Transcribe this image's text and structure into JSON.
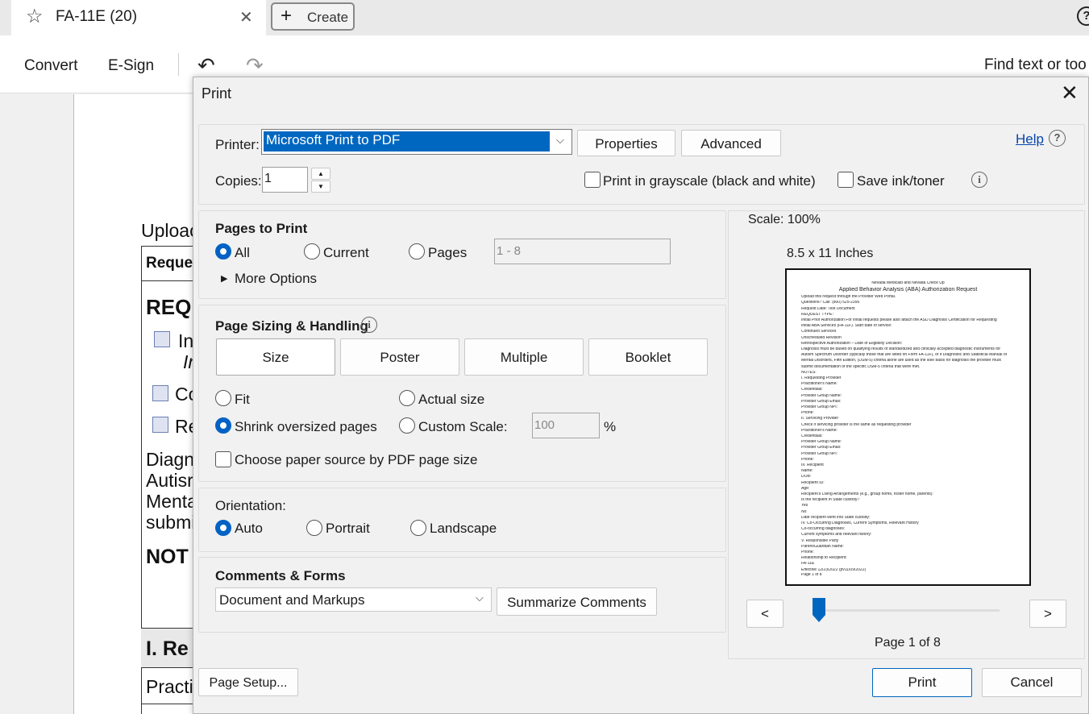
{
  "tab": {
    "title": "FA-11E (20)",
    "close": "✕"
  },
  "create": {
    "plus": "+",
    "label": "Create"
  },
  "help_q": "?",
  "toolbar": {
    "convert": "Convert",
    "esign": "E-Sign",
    "undo": "↶",
    "redo": "↷",
    "find": "Find text or too"
  },
  "document": {
    "lines": [
      "Uploac",
      "Reque",
      "REQ",
      "In",
      "In",
      "Co",
      "Re",
      "Diagn",
      "Autisr",
      "Menta",
      "submi",
      "NOT",
      "I. Re",
      "Practi"
    ]
  },
  "dialog": {
    "title": "Print",
    "close": "✕",
    "printer_label": "Printer:",
    "printer_value": "Microsoft Print to PDF",
    "chevron": "⌵",
    "properties": "Properties",
    "advanced": "Advanced",
    "help": "Help",
    "help_icon": "?",
    "copies_label": "Copies:",
    "copies_value": "1",
    "up": "▲",
    "down": "▼",
    "grayscale": "Print in grayscale (black and white)",
    "save_ink": "Save ink/toner",
    "info": "i",
    "pages_heading": "Pages to Print",
    "all": "All",
    "current": "Current",
    "pages": "Pages",
    "pages_placeholder": "1 - 8",
    "more_options": "More Options",
    "triangle": "▶",
    "sizing_heading": "Page Sizing & Handling",
    "size": "Size",
    "poster": "Poster",
    "multiple": "Multiple",
    "booklet": "Booklet",
    "fit": "Fit",
    "actual_size": "Actual size",
    "shrink": "Shrink oversized pages",
    "custom_scale": "Custom Scale:",
    "custom_value": "100",
    "percent": "%",
    "paper_source": "Choose paper source by PDF page size",
    "orientation_label": "Orientation:",
    "auto": "Auto",
    "portrait": "Portrait",
    "landscape": "Landscape",
    "comments_heading": "Comments & Forms",
    "comments_value": "Document and Markups",
    "summarize": "Summarize Comments",
    "page_setup": "Page Setup...",
    "print": "Print",
    "cancel": "Cancel"
  },
  "preview": {
    "scale": "Scale: 100%",
    "paper": "8.5 x 11 Inches",
    "prev": "<",
    "next": ">",
    "page_label": "Page 1 of 8",
    "slider_position": 0,
    "thumb_lines": [
      "Nevada Medicaid and Nevada Check Up",
      "Applied Behavior Analysis (ABA) Authorization Request",
      "Upload this request through the Provider Web Portal.",
      "Questions? Call: (800) 525-2395",
      "Request Date: Test Document",
      "REQUEST TYPE:",
      "Initial Prior Authorization For initial requests please also attach the ASD Diagnosis Certification for Requesting",
      "Initial ABA Services (FA-11F). Start date of service:",
      "Continued Services",
      "Unscheduled Revision",
      "Retrospective Authorization – Date of Eligibility Decision:",
      "Diagnosis must be based on qualifying results of standardized and clinically accepted diagnostic instruments for",
      "Autism Spectrum Disorder (typically those that are listed on Form FA-11F), or if Diagnostic and Statistical Manual of",
      "Mental Disorders, Fifth Edition, (DSM-5) criteria alone are used as the sole basis for diagnosis the provider must",
      "submit documentation of the specific DSM-5 criteria that were met.",
      "NOTES:",
      "I. Requesting Provider",
      "Practitioner's Name:",
      "Credentials:",
      "Provider Group Name:",
      "Provider Group Email:",
      "Provider Group NPI:",
      "Phone:",
      "II. Servicing Provider",
      "Check if servicing provider is the same as requesting provider",
      "Practitioner's Name:",
      "Credentials:",
      "Provider Group Name:",
      "Provider Group Email:",
      "Provider Group NPI:",
      "Phone:",
      "III. Recipient",
      "Name:",
      "DOB:",
      "Recipient ID:",
      "Age:",
      "Recipient's Living Arrangements (e.g., group home, foster home, parents):",
      "Is the recipient in State custody?",
      "Yes",
      "No",
      "Date recipient went into State custody:",
      "IV. Co-Occurring Diagnoses, Current Symptoms, Relevant History",
      "Co-occurring diagnoses:",
      "Current symptoms and relevant history:",
      "V. Responsible Party",
      "Parent/Guardian Name:",
      "Phone:",
      "Relationship to Recipient:",
      "FA-11E",
      "Effective 12/23/2022 (pv11/09/2022)",
      "Page 1 of 8"
    ]
  }
}
